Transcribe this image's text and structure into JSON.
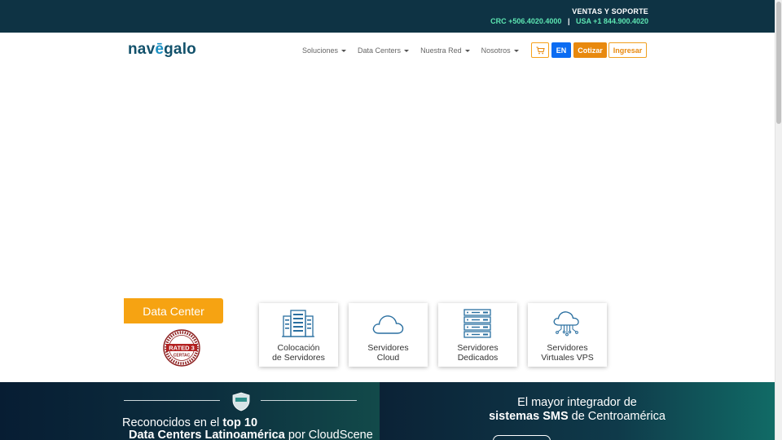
{
  "topbar": {
    "sales_label": "VENTAS Y SOPORTE",
    "phone_crc": "CRC +506.4020.4000",
    "separator": "|",
    "phone_usa": "USA +1 844.900.4020"
  },
  "nav": {
    "logo_start": "nav",
    "logo_accent": "ē",
    "logo_end": "galo",
    "menu": [
      {
        "label": "Soluciones"
      },
      {
        "label": "Data Centers"
      },
      {
        "label": "Nuestra Red"
      },
      {
        "label": "Nosotros"
      }
    ],
    "lang_label": "EN",
    "quote_label": "Cotizar",
    "login_label": "Ingresar"
  },
  "datacenter": {
    "tab_label": "Data Center",
    "badge_text": "RATED 3",
    "badge_sub": "CERTAC",
    "services": [
      {
        "line1": "Colocación",
        "line2": "de Servidores",
        "icon": "server-rack-icon"
      },
      {
        "line1": "Servidores",
        "line2": "Cloud",
        "icon": "cloud-icon"
      },
      {
        "line1": "Servidores",
        "line2": "Dedicados",
        "icon": "dedicated-server-icon"
      },
      {
        "line1": "Servidores",
        "line2": "Virtuales VPS",
        "icon": "cloud-network-icon"
      }
    ]
  },
  "banners": {
    "left_pre": "Reconocidos en el ",
    "left_bold": "top 10",
    "left_line2_bold": "Data Centers Latinoamérica",
    "left_line2_post": " por CloudScene",
    "right_line1": "El mayor integrador de",
    "right_bold": "sistemas SMS",
    "right_post": " de Centroamérica"
  },
  "colors": {
    "topbar_bg": "#0e3344",
    "phone_green": "#5de6b2",
    "brand_orange": "#f6a312",
    "lang_blue": "#0b6cf2"
  }
}
